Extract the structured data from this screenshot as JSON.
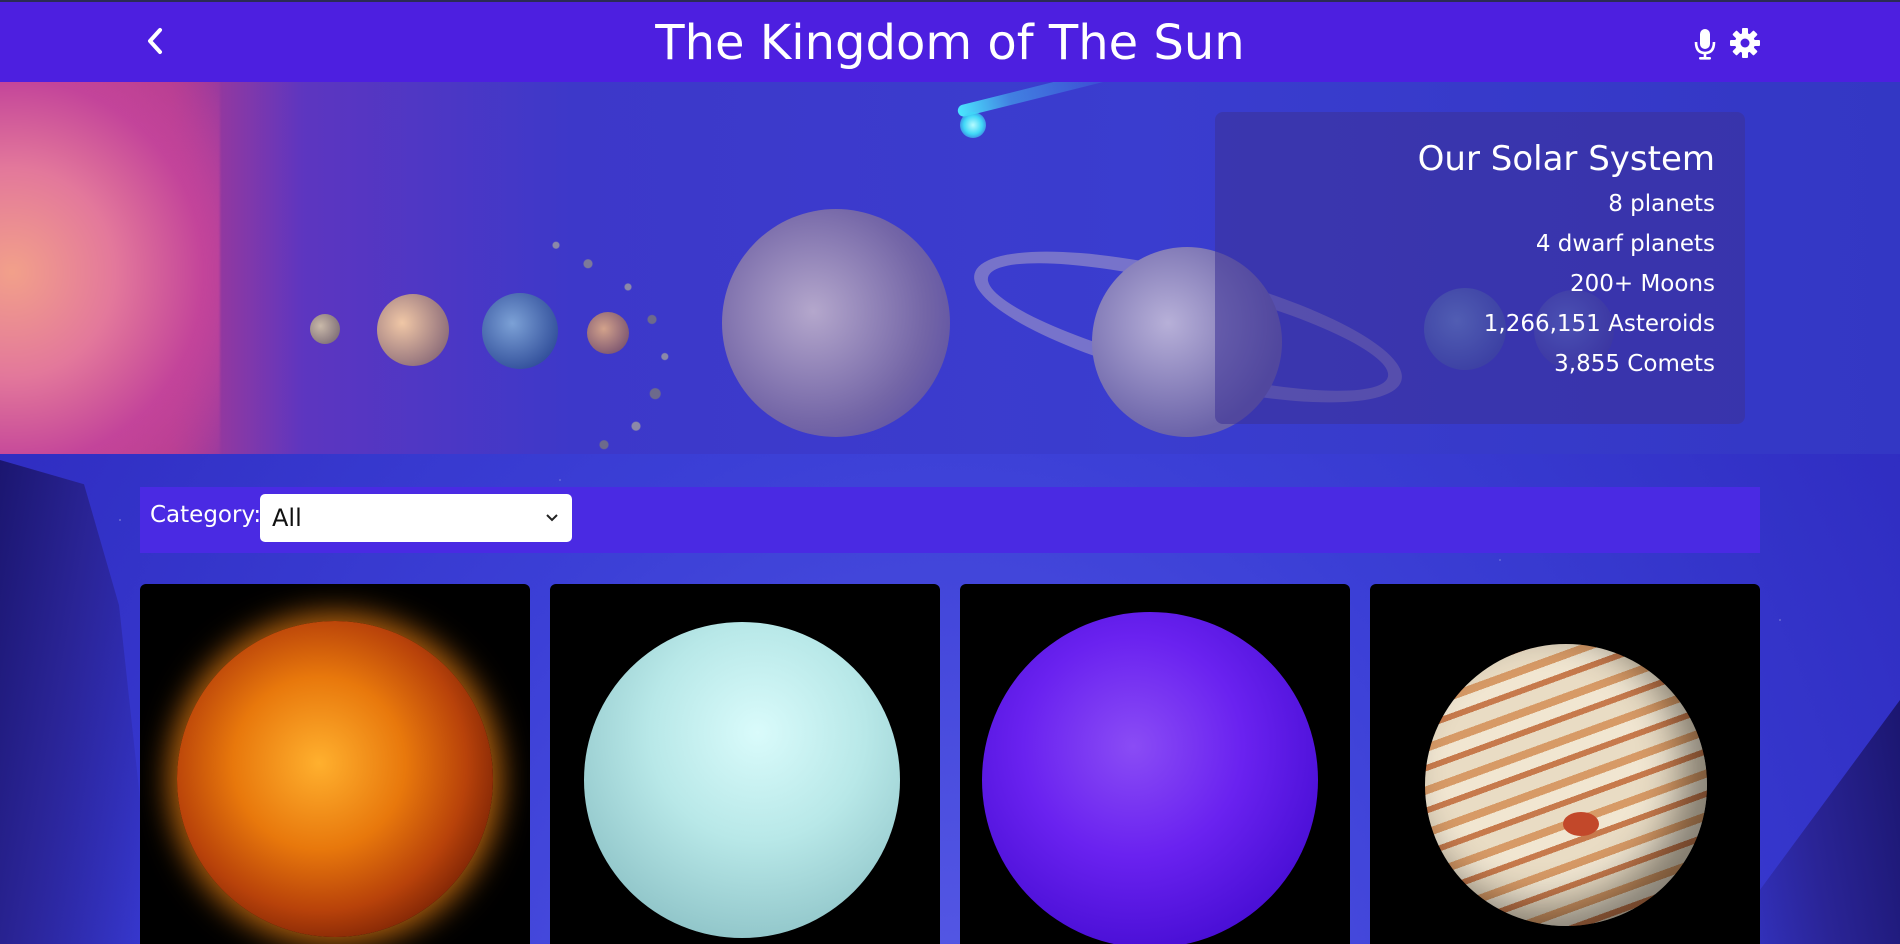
{
  "header": {
    "title": "The Kingdom of The Sun",
    "back_icon": "chevron-left-icon",
    "mic_icon": "microphone-icon",
    "settings_icon": "gear-icon"
  },
  "hero": {
    "panel_title": "Our Solar System",
    "stats": [
      "8 planets",
      "4 dwarf planets",
      "200+ Moons",
      "1,266,151 Asteroids",
      "3,855 Comets"
    ]
  },
  "filter": {
    "label": "Category:",
    "selected": "All"
  },
  "cards": [
    {
      "image": "sun"
    },
    {
      "image": "uranus"
    },
    {
      "image": "neptune"
    },
    {
      "image": "jupiter"
    }
  ],
  "colors": {
    "header_bg": "#4d1fe0",
    "filter_bar_bg": "#4a2ae3",
    "card_bg": "#000000"
  }
}
